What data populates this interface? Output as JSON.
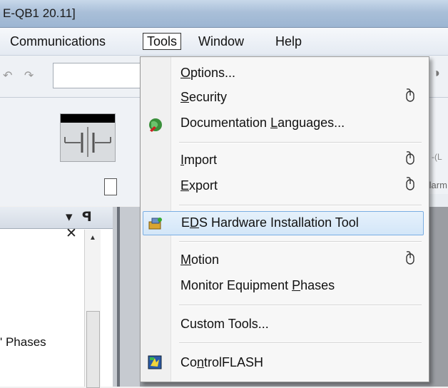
{
  "window": {
    "title": "E-QB1 20.11]"
  },
  "menubar": {
    "items": [
      {
        "label": "Communications",
        "active": false
      },
      {
        "label": "Tools",
        "active": true
      },
      {
        "label": "Window",
        "active": false
      },
      {
        "label": "Help",
        "active": false
      }
    ]
  },
  "toolbar": {
    "undo_icons": "↶ ↷",
    "right_icon": "glasses-icon"
  },
  "ribbon": {
    "right_tab_label": "Alarm",
    "right_symbol": "-(L"
  },
  "leftpane": {
    "controls": "▾ ꟼ ✕",
    "visible_text": "' Phases"
  },
  "tools_menu": {
    "items": [
      {
        "label": "Options...",
        "mnemonic": "O",
        "submenu_icon": null,
        "icon": null
      },
      {
        "label": "Security",
        "mnemonic": "S",
        "submenu_icon": "mouse-icon",
        "icon": null
      },
      {
        "label": "Documentation Languages...",
        "mnemonic": "L",
        "submenu_icon": null,
        "icon": "globe-icon"
      },
      {
        "label": "Import",
        "mnemonic": "I",
        "submenu_icon": "mouse-icon",
        "icon": null
      },
      {
        "label": "Export",
        "mnemonic": "E",
        "submenu_icon": "mouse-icon",
        "icon": null
      },
      {
        "label": "EDS Hardware Installation Tool",
        "mnemonic": "D",
        "submenu_icon": null,
        "icon": "hardware-wizard-icon",
        "highlighted": true
      },
      {
        "label": "Motion",
        "mnemonic": "M",
        "submenu_icon": "mouse-icon",
        "icon": null
      },
      {
        "label": "Monitor Equipment Phases",
        "mnemonic": "P",
        "submenu_icon": null,
        "icon": null
      },
      {
        "label": "Custom Tools...",
        "mnemonic": null,
        "submenu_icon": null,
        "icon": null
      },
      {
        "label": "ControlFLASH",
        "mnemonic": "n",
        "submenu_icon": null,
        "icon": "controlflash-icon"
      }
    ]
  },
  "colors": {
    "highlight_bg": "#d3e6f8",
    "highlight_border": "#7aaee3",
    "titlebar": "#a9bfd8"
  }
}
